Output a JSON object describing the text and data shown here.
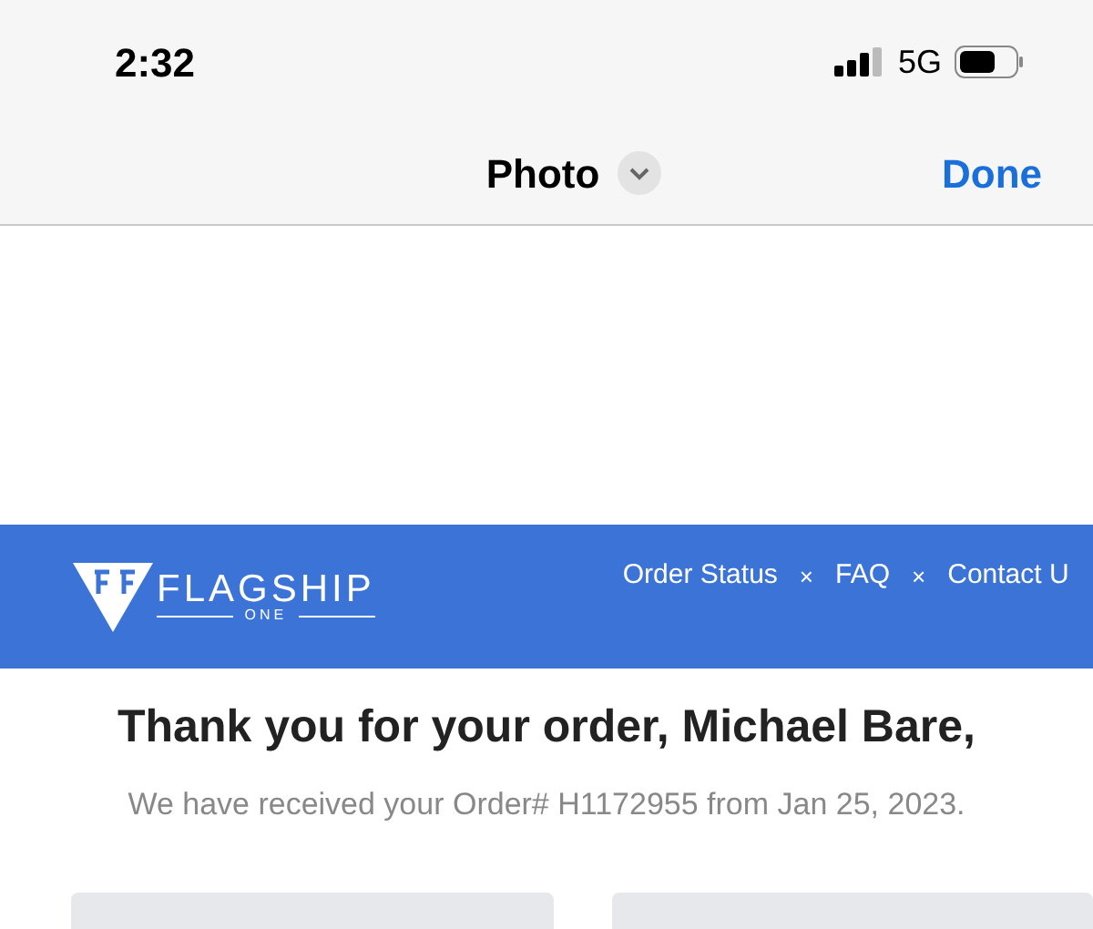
{
  "status_bar": {
    "time": "2:32",
    "network": "5G"
  },
  "nav_bar": {
    "title": "Photo",
    "done": "Done"
  },
  "email": {
    "brand": "FLAGSHIP",
    "brand_sub": "ONE",
    "links": [
      {
        "kind": "link",
        "label": "Order Status"
      },
      {
        "kind": "separator",
        "label": "×"
      },
      {
        "kind": "link",
        "label": "FAQ"
      },
      {
        "kind": "separator",
        "label": "×"
      },
      {
        "kind": "link",
        "label": "Contact U"
      }
    ],
    "heading": "Thank you for your order, Michael Bare,",
    "subtitle": "We have received your Order# H1172955 from Jan 25, 2023."
  }
}
